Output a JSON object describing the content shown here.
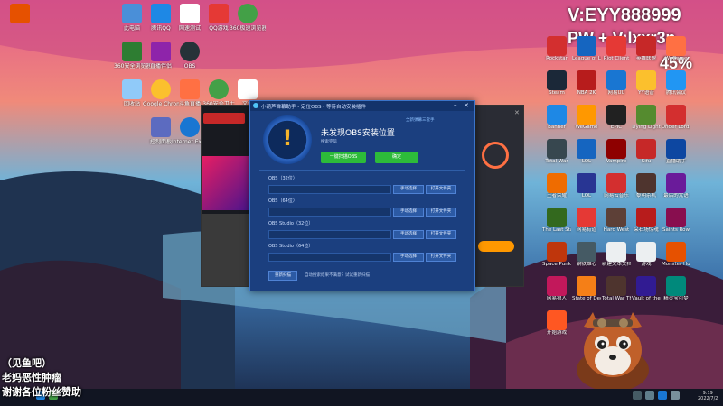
{
  "overlay": {
    "line1": "V:EYY888999",
    "line2": "PW + V:lxxr3n",
    "percent": "45%"
  },
  "desktop_left_icons": [
    {
      "label": "此电脑",
      "color": "#4a8fd8"
    },
    {
      "label": "腾讯QQ",
      "color": "#1e88e5"
    },
    {
      "label": "网速测试",
      "color": "#ffffff"
    },
    {
      "label": "QQ游戏",
      "color": "#e53935"
    },
    {
      "label": "360极速浏览器",
      "color": "#43a047"
    },
    {
      "label": "360安全浏览器",
      "color": "#2e7d32"
    },
    {
      "label": "直播伴侣",
      "color": "#8e24aa"
    },
    {
      "label": "OBS",
      "color": "#263238"
    },
    {
      "label": "回收站",
      "color": "#90caf9"
    },
    {
      "label": "Google Chrome",
      "color": "#fbc02d"
    },
    {
      "label": "斗鱼直播",
      "color": "#ff7043"
    },
    {
      "label": "360安全卫士",
      "color": "#43a047"
    },
    {
      "label": "Internet Explorer",
      "color": "#1976d2"
    },
    {
      "label": "文件",
      "color": "#ffffff"
    },
    {
      "label": "控制面板",
      "color": "#5c6bc0"
    }
  ],
  "desktop_right_icons": [
    {
      "label": "Rockstar",
      "color": "#d32f2f"
    },
    {
      "label": "League of Legends",
      "color": "#1565c0"
    },
    {
      "label": "Riot Client",
      "color": "#e53935"
    },
    {
      "label": "英雄联盟",
      "color": "#c62828"
    },
    {
      "label": "WeGame",
      "color": "#ff7043"
    },
    {
      "label": "Steam",
      "color": "#1b2838"
    },
    {
      "label": "NBA 2K",
      "color": "#b71c1c"
    },
    {
      "label": "网易UU",
      "color": "#1976d2"
    },
    {
      "label": "YY语音",
      "color": "#fbc02d"
    },
    {
      "label": "腾讯会议",
      "color": "#2196f3"
    },
    {
      "label": "Banner",
      "color": "#1e88e5"
    },
    {
      "label": "WeGame",
      "color": "#ff9800"
    },
    {
      "label": "EPIC",
      "color": "#212121"
    },
    {
      "label": "Dying Light",
      "color": "#558b2f"
    },
    {
      "label": "Under Lords",
      "color": "#d32f2f"
    },
    {
      "label": "Total War",
      "color": "#37474f"
    },
    {
      "label": "LOL",
      "color": "#1565c0"
    },
    {
      "label": "Vampire",
      "color": "#8e0000"
    },
    {
      "label": "Sifu",
      "color": "#c62828"
    },
    {
      "label": "直播助手",
      "color": "#0d47a1"
    },
    {
      "label": "王者荣耀",
      "color": "#ef6c00"
    },
    {
      "label": "LOL",
      "color": "#283593"
    },
    {
      "label": "网易云音乐",
      "color": "#d32f2f"
    },
    {
      "label": "黎明杀机",
      "color": "#4e342e"
    },
    {
      "label": "最后的咒语",
      "color": "#6a1b9a"
    },
    {
      "label": "The Last Stand",
      "color": "#33691e"
    },
    {
      "label": "网易有道",
      "color": "#e53935"
    },
    {
      "label": "Hard West",
      "color": "#5d4037"
    },
    {
      "label": "采石场惊魂",
      "color": "#b71c1c"
    },
    {
      "label": "Saints Row",
      "color": "#880e4f"
    },
    {
      "label": "Space Punks",
      "color": "#bf360c"
    },
    {
      "label": "钢铁雄心",
      "color": "#455a64"
    },
    {
      "label": "新建文本文档",
      "color": "#eceff1"
    },
    {
      "label": "游戏",
      "color": "#eceff1"
    },
    {
      "label": "Monster Hunter",
      "color": "#e65100"
    },
    {
      "label": "网易狼人",
      "color": "#c2185b"
    },
    {
      "label": "State of Decay 2",
      "color": "#f57f17"
    },
    {
      "label": "Total War THREE",
      "color": "#4e342e"
    },
    {
      "label": "Vault of the Void",
      "color": "#311b92"
    },
    {
      "label": "精灵宝可梦",
      "color": "#00897b"
    },
    {
      "label": "开始游戏",
      "color": "#ff5722"
    }
  ],
  "dialog": {
    "title": "小葫芦弹幕助手 - 定位OBS - 等待自动安装插件",
    "top_link": "全新弹幕三套手",
    "heading": "未发现OBS安装位置",
    "subheading": "搜索完毕",
    "btn_search": "一键扫描OBS",
    "btn_confirm": "确定",
    "rows": [
      {
        "label": "OBS（32位）",
        "manual": "手动选择",
        "open": "打开文件夹"
      },
      {
        "label": "OBS（64位）",
        "manual": "手动选择",
        "open": "打开文件夹"
      },
      {
        "label": "OBS Studio（32位）",
        "manual": "手动选择",
        "open": "打开文件夹"
      },
      {
        "label": "OBS Studio（64位）",
        "manual": "手动选择",
        "open": "打开文件夹"
      }
    ],
    "footer_btn": "重新扫描",
    "footer_text": "自动搜索结果不满意？试试重新扫描"
  },
  "bottom_lines": [
    "（见鱼吧）",
    "老妈恶性肿瘤",
    "谢谢各位粉丝赞助"
  ],
  "taskbar": {
    "time": "9:19",
    "date": "2022/7/2"
  },
  "colors": {
    "accent": "#2dbb3a",
    "dialog_bg": "#1b3f7f",
    "warning": "#f6b52b"
  }
}
